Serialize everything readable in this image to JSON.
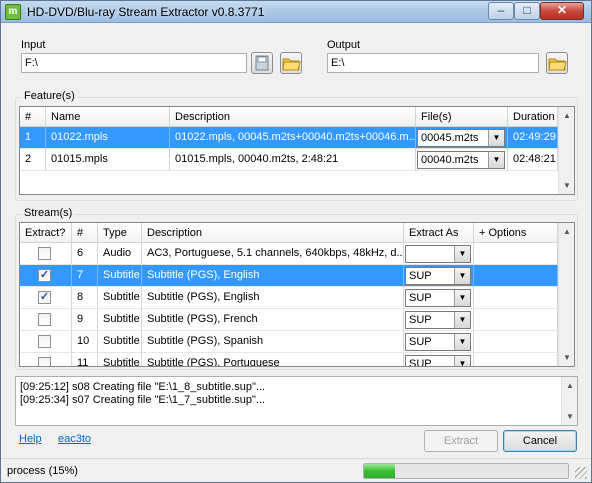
{
  "window": {
    "title": "HD-DVD/Blu-ray Stream Extractor v0.8.3771",
    "icon_letter": "m"
  },
  "input": {
    "label": "Input",
    "value": "F:\\"
  },
  "output": {
    "label": "Output",
    "value": "E:\\"
  },
  "features": {
    "group_title": "Feature(s)",
    "columns": [
      "#",
      "Name",
      "Description",
      "File(s)",
      "Duration"
    ],
    "rows": [
      {
        "num": "1",
        "name": "01022.mpls",
        "description": "01022.mpls, 00045.m2ts+00040.m2ts+00046.m...",
        "file": "00045.m2ts",
        "duration": "02:49:29",
        "selected": true
      },
      {
        "num": "2",
        "name": "01015.mpls",
        "description": "01015.mpls, 00040.m2ts, 2:48:21",
        "file": "00040.m2ts",
        "duration": "02:48:21",
        "selected": false
      }
    ]
  },
  "streams": {
    "group_title": "Stream(s)",
    "columns": [
      "Extract?",
      "#",
      "Type",
      "Description",
      "Extract As",
      "+ Options"
    ],
    "rows": [
      {
        "checked": false,
        "num": "6",
        "type": "Audio",
        "description": "AC3, Portuguese, 5.1 channels, 640kbps, 48kHz, d...",
        "extract_as": "",
        "selected": false
      },
      {
        "checked": true,
        "num": "7",
        "type": "Subtitle",
        "description": "Subtitle (PGS), English",
        "extract_as": "SUP",
        "selected": true
      },
      {
        "checked": true,
        "num": "8",
        "type": "Subtitle",
        "description": "Subtitle (PGS), English",
        "extract_as": "SUP",
        "selected": false
      },
      {
        "checked": false,
        "num": "9",
        "type": "Subtitle",
        "description": "Subtitle (PGS), French",
        "extract_as": "SUP",
        "selected": false
      },
      {
        "checked": false,
        "num": "10",
        "type": "Subtitle",
        "description": "Subtitle (PGS), Spanish",
        "extract_as": "SUP",
        "selected": false
      },
      {
        "checked": false,
        "num": "11",
        "type": "Subtitle",
        "description": "Subtitle (PGS), Portuguese",
        "extract_as": "SUP",
        "selected": false
      }
    ]
  },
  "log": {
    "lines": [
      "[09:25:12] s08 Creating file \"E:\\1_8_subtitle.sup\"...",
      "[09:25:34] s07 Creating file \"E:\\1_7_subtitle.sup\"..."
    ]
  },
  "links": {
    "help": "Help",
    "eac3to": "eac3to"
  },
  "buttons": {
    "extract": "Extract",
    "cancel": "Cancel"
  },
  "status": {
    "text": "process (15%)",
    "progress_percent": 15
  },
  "icons": {
    "folder": "folder-open-icon",
    "disk": "save-disk-icon"
  }
}
